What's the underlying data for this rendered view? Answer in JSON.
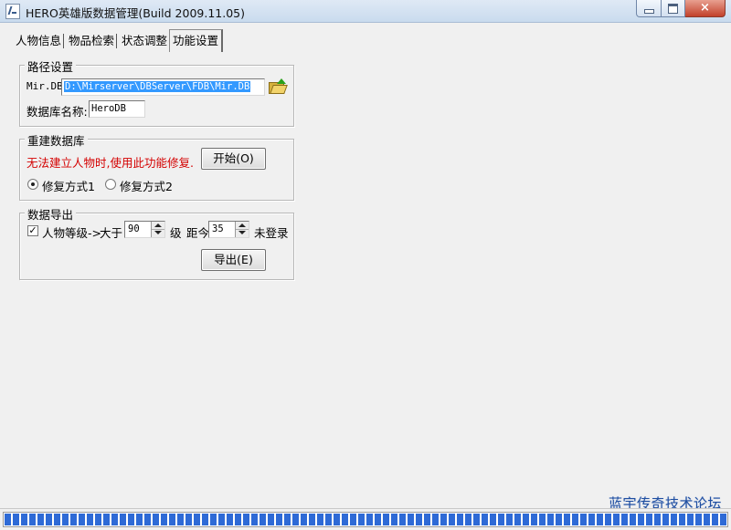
{
  "window": {
    "title": "HERO英雄版数据管理(Build 2009.11.05)",
    "close_label": "×"
  },
  "tabs": [
    {
      "label": "人物信息"
    },
    {
      "label": "物品检索"
    },
    {
      "label": "状态调整"
    },
    {
      "label": "功能设置",
      "active": true
    }
  ],
  "path_settings": {
    "title": "路径设置",
    "mir_db_label": "Mir.DB",
    "mir_db_value": "D:\\Mirserver\\DBServer\\FDB\\Mir.DB",
    "db_name_label": "数据库名称:",
    "db_name_value": "HeroDB"
  },
  "rebuild": {
    "title": "重建数据库",
    "warning": "无法建立人物时,使用此功能修复.",
    "warning_color": "#d40000",
    "start_button": "开始(O)",
    "option1": "修复方式1",
    "option2": "修复方式2",
    "selected_option": 1
  },
  "export": {
    "title": "数据导出",
    "checkbox_label": "人物等级->",
    "checked": true,
    "check_mark": "✓",
    "greater_than": "大于",
    "level_value": "90",
    "level_unit": "级",
    "distance_label": "距今",
    "days_value": "35",
    "not_logged": "未登录",
    "export_button": "导出(E)"
  },
  "watermark": "蓝宇传奇技术论坛",
  "progress": {
    "fraction": 1.0,
    "accent": "#2e6ad6"
  }
}
